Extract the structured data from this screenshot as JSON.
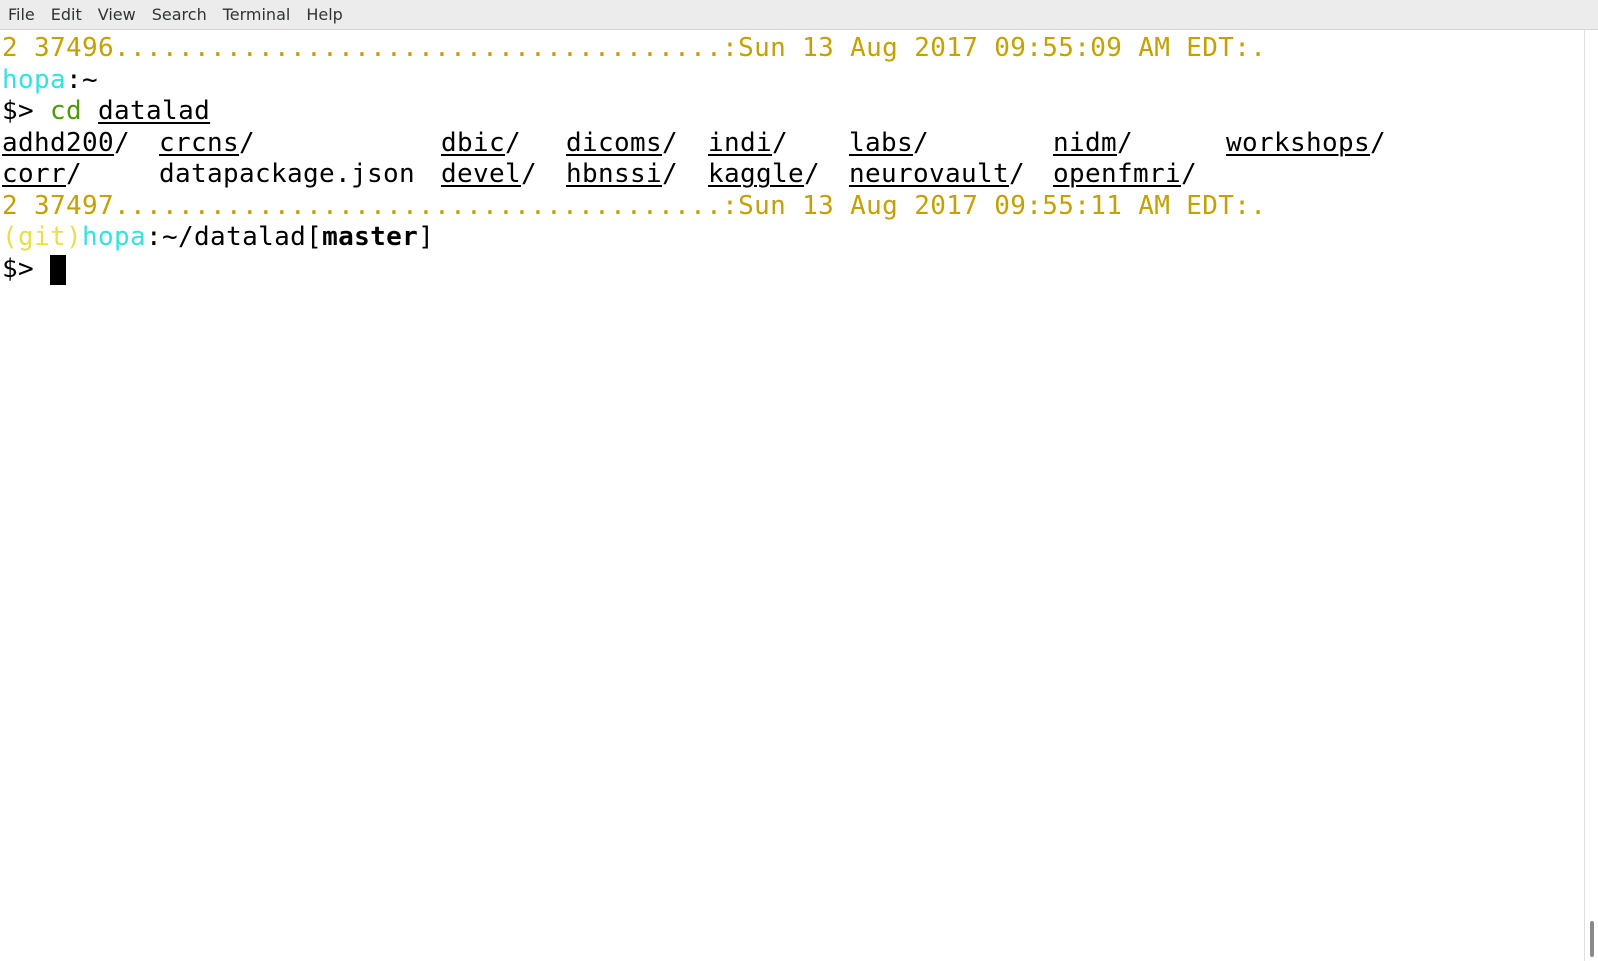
{
  "menubar": {
    "items": [
      "File",
      "Edit",
      "View",
      "Search",
      "Terminal",
      "Help"
    ]
  },
  "terminal": {
    "status1": "2 37496......................................:Sun 13 Aug 2017 09:55:09 AM EDT:.",
    "prompt1_host": "hopa",
    "prompt1_path": ":~",
    "cmd_prompt": "$> ",
    "cmd_name": "cd",
    "cmd_arg": "datalad",
    "listing": {
      "row1": [
        {
          "name": "adhd200",
          "suffix": "/"
        },
        {
          "name": "crcns",
          "suffix": "/"
        },
        {
          "name": "dbic",
          "suffix": "/"
        },
        {
          "name": "dicoms",
          "suffix": "/"
        },
        {
          "name": "indi",
          "suffix": "/"
        },
        {
          "name": "labs",
          "suffix": "/"
        },
        {
          "name": "nidm",
          "suffix": "/"
        },
        {
          "name": "workshops",
          "suffix": "/"
        }
      ],
      "row2": [
        {
          "name": "corr",
          "suffix": "/"
        },
        {
          "name": "datapackage.json",
          "suffix": ""
        },
        {
          "name": "devel",
          "suffix": "/"
        },
        {
          "name": "hbnssi",
          "suffix": "/"
        },
        {
          "name": "kaggle",
          "suffix": "/"
        },
        {
          "name": "neurovault",
          "suffix": "/"
        },
        {
          "name": "openfmri",
          "suffix": "/"
        }
      ]
    },
    "status2": "2 37497......................................:Sun 13 Aug 2017 09:55:11 AM EDT:.",
    "prompt2_vcs": "(git)",
    "prompt2_host": "hopa",
    "prompt2_path": ":~/datalad[",
    "prompt2_branch": "master",
    "prompt2_close": "]",
    "cmd_prompt2": "$> "
  },
  "colors": {
    "status": "#c4a000",
    "vcs": "#e8e04a",
    "host": "#34e2e2",
    "command": "#4e9a06"
  }
}
